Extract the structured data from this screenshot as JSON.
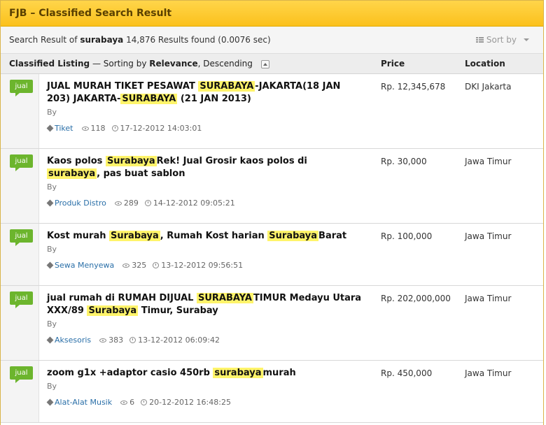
{
  "title": "FJB – Classified Search Result",
  "summary": {
    "prefix": "Search Result of",
    "query": "surabaya",
    "results": "14,876 Results found (0.0076 sec)",
    "sort_label": "Sort by"
  },
  "header": {
    "listing_label": "Classified Listing",
    "sorting_text": "— Sorting by",
    "sorting_field": "Relevance",
    "sorting_order": ", Descending",
    "price_label": "Price",
    "location_label": "Location"
  },
  "listings": [
    {
      "badge": "jual",
      "title_parts": [
        {
          "t": "JUAL MURAH TIKET PESAWAT ",
          "hl": false
        },
        {
          "t": "SURABAYA",
          "hl": true
        },
        {
          "t": "-JAKARTA(18 JAN 203) JAKARTA-",
          "hl": false
        },
        {
          "t": "SURABAYA",
          "hl": true
        },
        {
          "t": " (21 JAN 2013)",
          "hl": false
        }
      ],
      "by": "By",
      "tag": "Tiket",
      "views": "118",
      "date": "17-12-2012 14:03:01",
      "price": "Rp. 12,345,678",
      "location": "DKI Jakarta"
    },
    {
      "badge": "jual",
      "title_parts": [
        {
          "t": "Kaos polos ",
          "hl": false
        },
        {
          "t": "Surabaya",
          "hl": true
        },
        {
          "t": "Rek! Jual Grosir kaos polos di ",
          "hl": false
        },
        {
          "t": "surabaya",
          "hl": true
        },
        {
          "t": ", pas buat sablon",
          "hl": false
        }
      ],
      "by": "By",
      "tag": "Produk Distro",
      "views": "289",
      "date": "14-12-2012 09:05:21",
      "price": "Rp. 30,000",
      "location": "Jawa Timur"
    },
    {
      "badge": "jual",
      "title_parts": [
        {
          "t": "Kost murah ",
          "hl": false
        },
        {
          "t": "Surabaya",
          "hl": true
        },
        {
          "t": ", Rumah Kost harian ",
          "hl": false
        },
        {
          "t": "Surabaya",
          "hl": true
        },
        {
          "t": "Barat",
          "hl": false
        }
      ],
      "by": "By",
      "tag": "Sewa Menyewa",
      "views": "325",
      "date": "13-12-2012 09:56:51",
      "price": "Rp. 100,000",
      "location": "Jawa Timur"
    },
    {
      "badge": "jual",
      "title_parts": [
        {
          "t": "jual rumah di RUMAH DIJUAL ",
          "hl": false
        },
        {
          "t": "SURABAYA",
          "hl": true
        },
        {
          "t": "TIMUR Medayu Utara XXX/89 ",
          "hl": false
        },
        {
          "t": "Surabaya",
          "hl": true
        },
        {
          "t": " Timur, Surabay",
          "hl": false
        }
      ],
      "by": "By",
      "tag": "Aksesoris",
      "views": "383",
      "date": "13-12-2012 06:09:42",
      "price": "Rp. 202,000,000",
      "location": "Jawa Timur"
    },
    {
      "badge": "jual",
      "title_parts": [
        {
          "t": "zoom g1x +adaptor casio 450rb ",
          "hl": false
        },
        {
          "t": "surabaya",
          "hl": true
        },
        {
          "t": "murah",
          "hl": false
        }
      ],
      "by": "By",
      "tag": "Alat-Alat Musik",
      "views": "6",
      "date": "20-12-2012 16:48:25",
      "price": "Rp. 450,000",
      "location": "Jawa Timur"
    }
  ]
}
